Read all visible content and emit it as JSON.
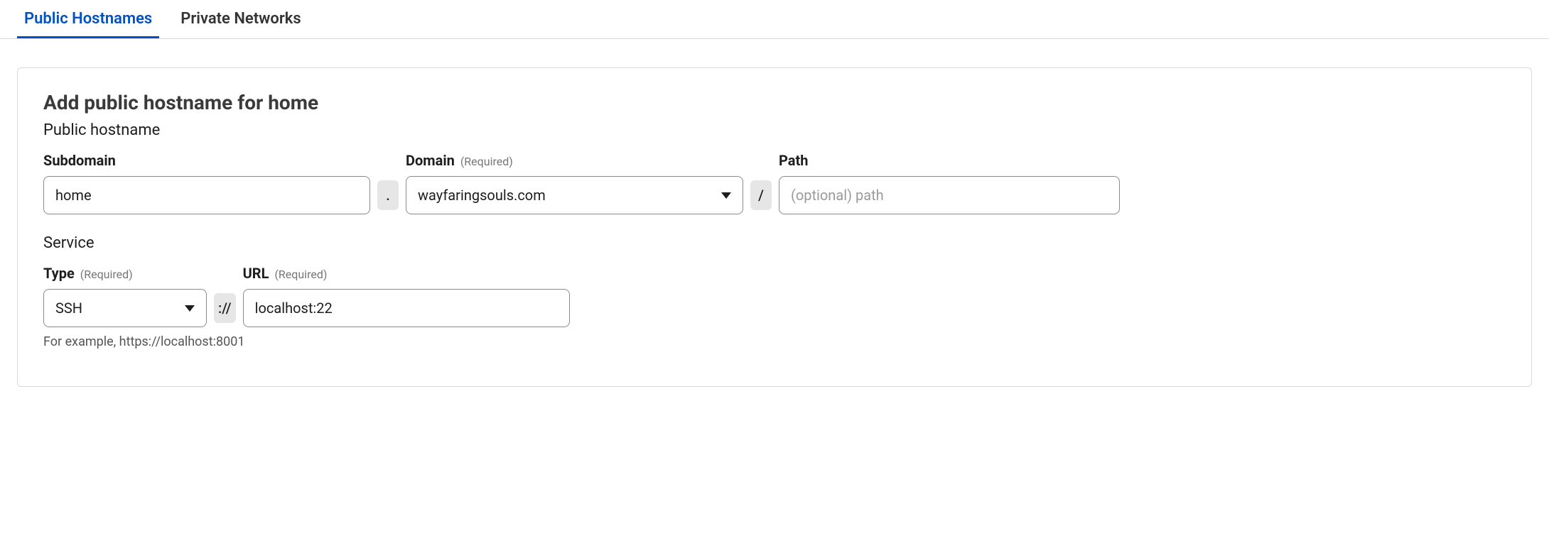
{
  "tabs": {
    "public": "Public Hostnames",
    "private": "Private Networks"
  },
  "panel": {
    "title": "Add public hostname for home"
  },
  "hostname": {
    "section_label": "Public hostname",
    "subdomain_label": "Subdomain",
    "subdomain_value": "home",
    "domain_label": "Domain",
    "domain_required": "(Required)",
    "domain_value": "wayfaringsouls.com",
    "path_label": "Path",
    "path_placeholder": "(optional) path",
    "dot_separator": ".",
    "slash_separator": "/"
  },
  "service": {
    "section_label": "Service",
    "type_label": "Type",
    "type_required": "(Required)",
    "type_value": "SSH",
    "url_label": "URL",
    "url_required": "(Required)",
    "url_value": "localhost:22",
    "scheme_separator": "://",
    "hint": "For example, https://localhost:8001"
  }
}
